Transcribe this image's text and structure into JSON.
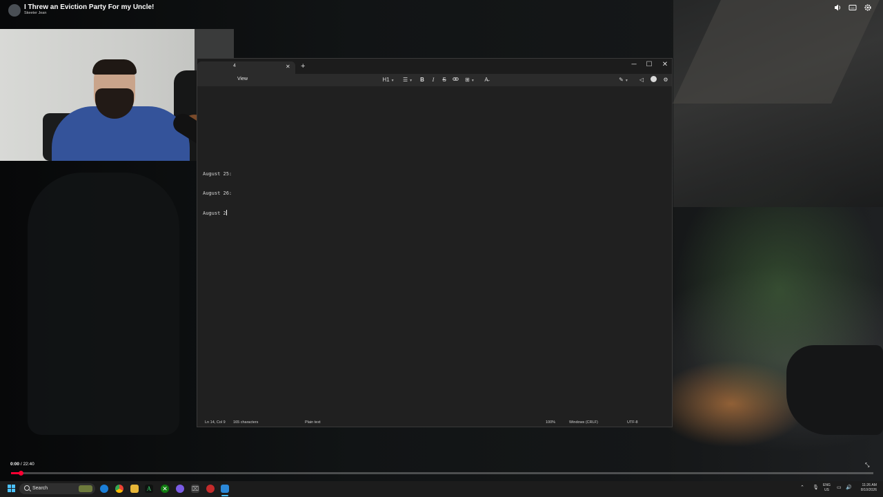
{
  "video": {
    "title": "I Threw an Eviction Party For my Uncle!",
    "channel": "Skeeter Jean",
    "controls": [
      "volume-icon",
      "captions-icon",
      "settings-icon"
    ],
    "current_time": "0:00",
    "duration": "/ 22:40",
    "progress_fraction": 0.0,
    "accent_color": "#ff0033"
  },
  "notepad": {
    "tab_marker": "4",
    "menu": {
      "view": "View"
    },
    "toolbar": {
      "heading": "H1"
    },
    "editor": {
      "lines": [
        "August 25:",
        "August 26:",
        "August 2"
      ]
    },
    "status": {
      "position": "Ln 14, Col 9",
      "characters": "165 characters",
      "format": "Plain text",
      "zoom": "100%",
      "line_ending": "Windows (CRLF)",
      "encoding": "UTF-8"
    }
  },
  "taskbar": {
    "search_placeholder": "Search",
    "lang_primary": "ENG",
    "lang_secondary": "US",
    "time": "11:26 AM",
    "date": "8/10/2026",
    "accent_color": "#4cc2ff"
  }
}
